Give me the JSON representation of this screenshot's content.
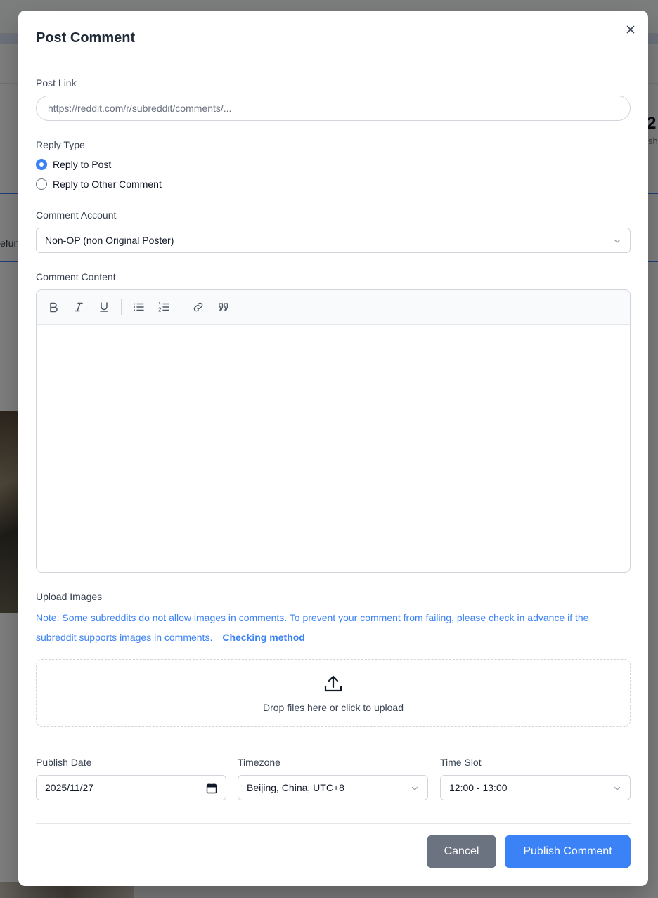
{
  "background": {
    "stat_number": "2",
    "stat_label": "sh",
    "side_text": "efun"
  },
  "modal": {
    "title": "Post Comment",
    "close_icon": "close-icon"
  },
  "post_link": {
    "label": "Post Link",
    "value": "",
    "placeholder": "https://reddit.com/r/subreddit/comments/..."
  },
  "reply_type": {
    "label": "Reply Type",
    "options": [
      {
        "label": "Reply to Post",
        "checked": true
      },
      {
        "label": "Reply to Other Comment",
        "checked": false
      }
    ]
  },
  "comment_account": {
    "label": "Comment Account",
    "selected": "Non-OP (non Original Poster)"
  },
  "comment_content": {
    "label": "Comment Content",
    "toolbar": [
      "bold-icon",
      "italic-icon",
      "underline-icon",
      "bullet-list-icon",
      "numbered-list-icon",
      "link-icon",
      "quote-icon"
    ],
    "value": ""
  },
  "upload_images": {
    "label": "Upload Images",
    "note": "Note: Some subreddits do not allow images in comments. To prevent your comment from failing, please check in advance if the subreddit supports images in comments.",
    "note_link": "Checking method",
    "dropzone_text": "Drop files here or click to upload",
    "dropzone_icon": "upload-icon"
  },
  "schedule": {
    "date_label": "Publish Date",
    "date_value": "2025/11/27",
    "timezone_label": "Timezone",
    "timezone_value": "Beijing, China, UTC+8",
    "timeslot_label": "Time Slot",
    "timeslot_value": "12:00 - 13:00"
  },
  "actions": {
    "cancel_label": "Cancel",
    "publish_label": "Publish Comment"
  },
  "colors": {
    "accent": "#3b82f6",
    "cancel": "#6b7280",
    "border": "#d1d5db"
  }
}
